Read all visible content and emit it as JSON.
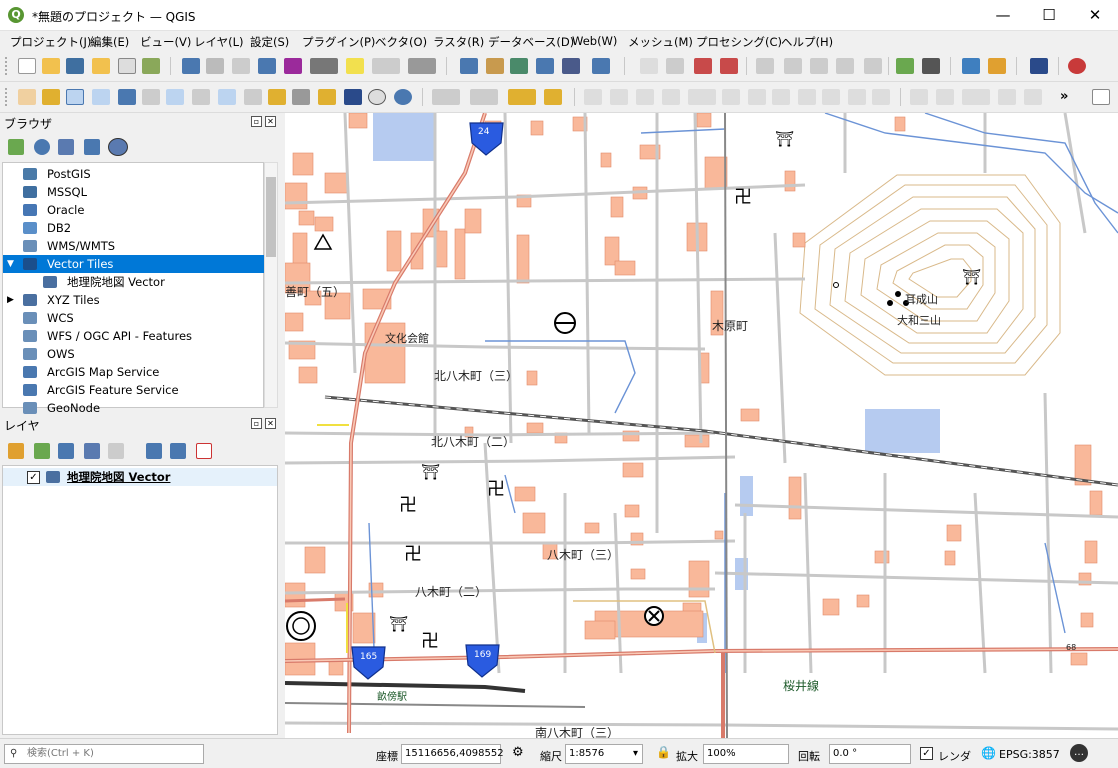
{
  "window": {
    "title": "*無題のプロジェクト — QGIS",
    "app_icon": "Q",
    "minimize": "—",
    "maximize": "☐",
    "close": "✕"
  },
  "menubar": [
    "プロジェクト(J)",
    "編集(E)",
    "ビュー(V)",
    "レイヤ(L)",
    "設定(S)",
    "プラグイン(P)",
    "ベクタ(O)",
    "ラスタ(R)",
    "データベース(D)",
    "Web(W)",
    "メッシュ(M)",
    "プロセシング(C)",
    "ヘルプ(H)"
  ],
  "browser": {
    "title": "ブラウザ",
    "items": [
      {
        "label": "PostGIS",
        "icon": "postgis-icon",
        "color": "#4a7aa8",
        "indent": 1
      },
      {
        "label": "MSSQL",
        "icon": "mssql-icon",
        "color": "#3f6fa0",
        "indent": 1
      },
      {
        "label": "Oracle",
        "icon": "oracle-icon",
        "color": "#4676b4",
        "indent": 1
      },
      {
        "label": "DB2",
        "icon": "db2-icon",
        "color": "#5a8fc9",
        "indent": 1
      },
      {
        "label": "WMS/WMTS",
        "icon": "globe-icon",
        "color": "#6a8fb8",
        "indent": 1
      },
      {
        "label": "Vector Tiles",
        "icon": "grid-icon",
        "color": "#1b4f8c",
        "indent": 1,
        "selected": true,
        "expanded": true
      },
      {
        "label": "地理院地図 Vector",
        "icon": "grid-icon",
        "color": "#4a6fa0",
        "indent": 2
      },
      {
        "label": "XYZ Tiles",
        "icon": "grid-icon",
        "color": "#4a6fa0",
        "indent": 1,
        "collapsed": true
      },
      {
        "label": "WCS",
        "icon": "globe-icon",
        "color": "#6a8fb8",
        "indent": 1
      },
      {
        "label": "WFS / OGC API - Features",
        "icon": "globe-icon",
        "color": "#6a8fb8",
        "indent": 1
      },
      {
        "label": "OWS",
        "icon": "globe-icon",
        "color": "#6a8fb8",
        "indent": 1
      },
      {
        "label": "ArcGIS Map Service",
        "icon": "arcgis-icon",
        "color": "#4a78b0",
        "indent": 1
      },
      {
        "label": "ArcGIS Feature Service",
        "icon": "arcgis-icon",
        "color": "#4a78b0",
        "indent": 1
      },
      {
        "label": "GeoNode",
        "icon": "geonode-icon",
        "color": "#6a8fb8",
        "indent": 1
      }
    ]
  },
  "layers": {
    "title": "レイヤ",
    "items": [
      {
        "label": "地理院地図 Vector",
        "checked": true
      }
    ]
  },
  "map": {
    "labels": [
      "善町（五）",
      "文化会館",
      "木原町",
      "北八木町（三）",
      "北八木町（二）",
      "八木町（三）",
      "八木町（二）",
      "南八木町（三）",
      "桜井線",
      "耳成山",
      "大和三山",
      "畝傍駅"
    ],
    "route_shields": [
      "24",
      "165",
      "169"
    ],
    "edge_number": "68"
  },
  "status": {
    "search_placeholder": "検索(Ctrl + K)",
    "coord_label": "座標",
    "coord_value": "15116656,4098552",
    "scale_label": "縮尺",
    "scale_value": "1:8576",
    "magnifier_label": "拡大",
    "magnifier_value": "100%",
    "rotation_label": "回転",
    "rotation_value": "0.0 °",
    "render_label": "レンダ",
    "render_checked": true,
    "crs": "EPSG:3857"
  },
  "colors": {
    "accent": "#0078d7",
    "road_main": "#d87a6a",
    "building": "#f9b89a",
    "water": "#b6cbf0"
  }
}
